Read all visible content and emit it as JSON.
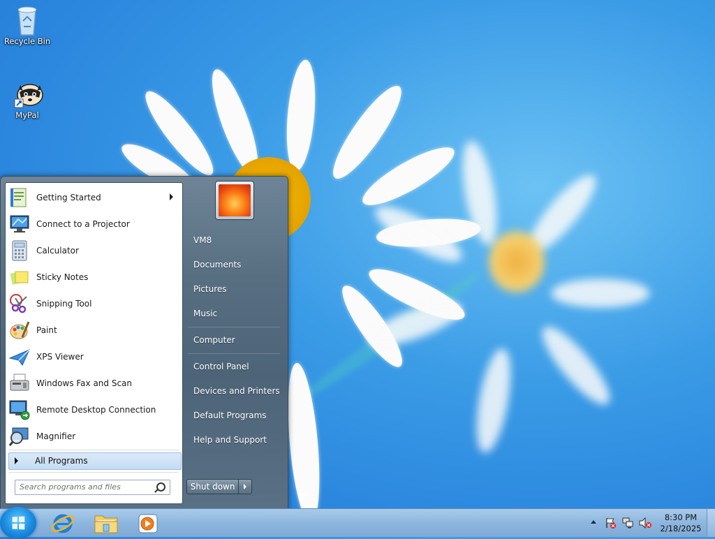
{
  "desktop": {
    "icons": [
      {
        "label": "Recycle Bin",
        "icon": "recycle-bin-icon"
      },
      {
        "label": "MyPal",
        "icon": "raccoon-app-icon"
      }
    ]
  },
  "start_menu": {
    "programs": [
      {
        "label": "Getting Started",
        "icon": "getting-started-icon",
        "has_submenu": true
      },
      {
        "label": "Connect to a Projector",
        "icon": "projector-icon"
      },
      {
        "label": "Calculator",
        "icon": "calculator-icon"
      },
      {
        "label": "Sticky Notes",
        "icon": "sticky-notes-icon"
      },
      {
        "label": "Snipping Tool",
        "icon": "scissors-icon"
      },
      {
        "label": "Paint",
        "icon": "palette-icon"
      },
      {
        "label": "XPS Viewer",
        "icon": "paper-plane-icon"
      },
      {
        "label": "Windows Fax and Scan",
        "icon": "fax-icon"
      },
      {
        "label": "Remote Desktop Connection",
        "icon": "remote-desktop-icon"
      },
      {
        "label": "Magnifier",
        "icon": "magnifier-icon"
      }
    ],
    "all_programs_label": "All Programs",
    "search_placeholder": "Search programs and files",
    "user_name": "VM8",
    "right_items": [
      "Documents",
      "Pictures",
      "Music",
      "Computer",
      "Control Panel",
      "Devices and Printers",
      "Default Programs",
      "Help and Support"
    ],
    "shutdown_label": "Shut down"
  },
  "taskbar": {
    "pinned": [
      {
        "name": "Internet Explorer",
        "icon": "internet-explorer-icon"
      },
      {
        "name": "File Explorer",
        "icon": "folder-icon"
      },
      {
        "name": "Windows Media Player",
        "icon": "media-player-icon"
      }
    ],
    "tray_icons": [
      "show-hidden-icons-arrow",
      "action-center-flag-icon",
      "network-icon",
      "volume-muted-icon"
    ],
    "time": "8:30 PM",
    "date": "2/18/2025"
  },
  "colors": {
    "accent": "#2b87de",
    "taskbar": "#8db6df",
    "start_menu_right": "#586f82"
  }
}
